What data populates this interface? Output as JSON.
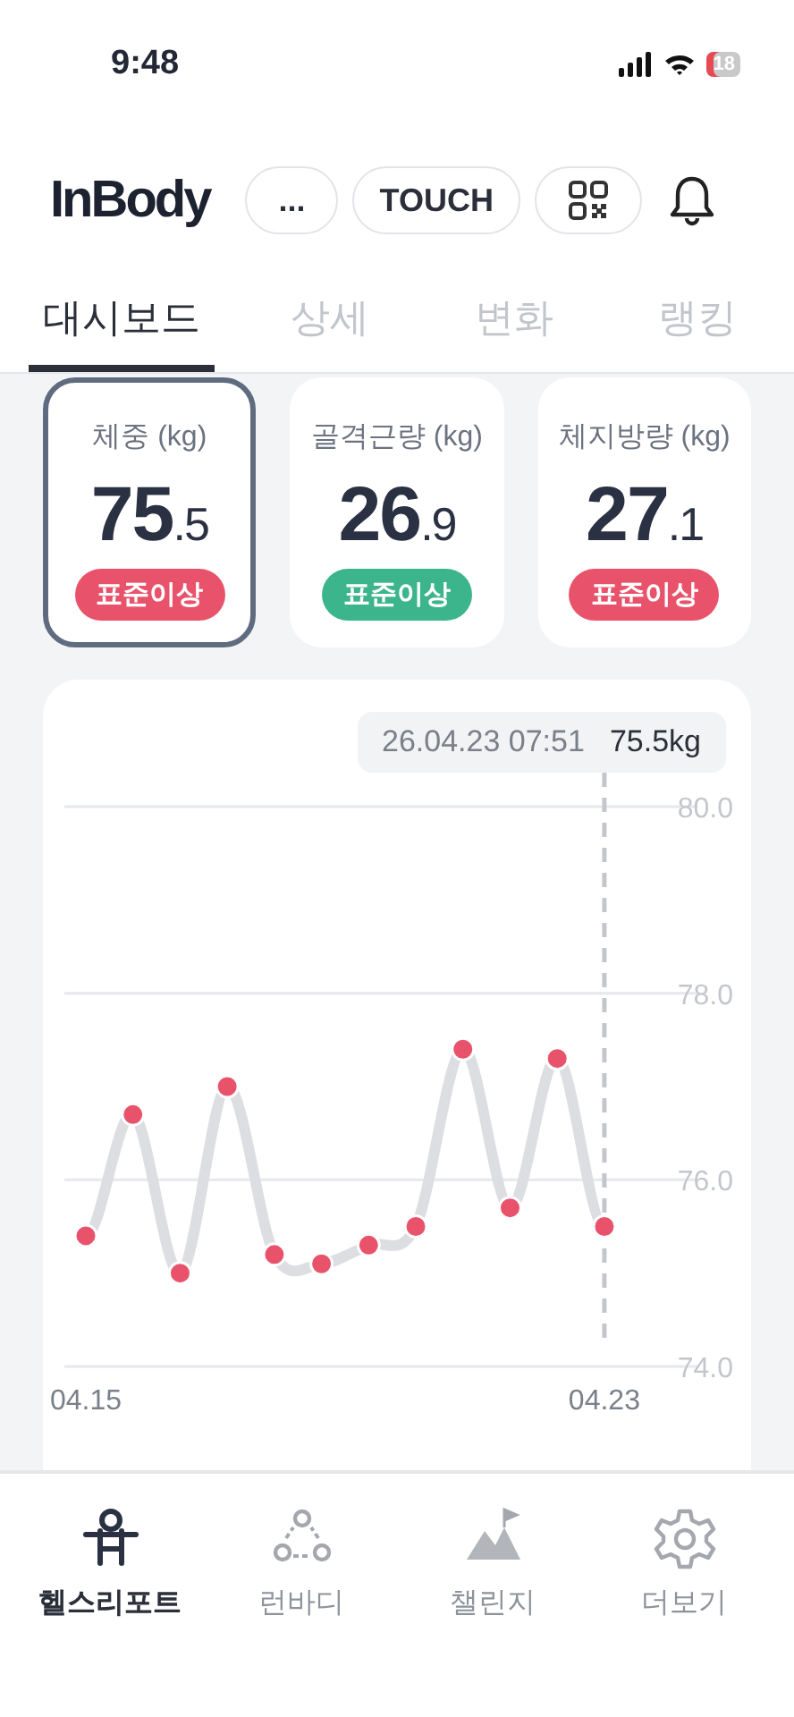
{
  "status_bar": {
    "time": "9:48",
    "battery": "18"
  },
  "header": {
    "logo": "InBody",
    "buttons": [
      {
        "kind": "text",
        "label": "..."
      },
      {
        "kind": "text",
        "label": "TOUCH"
      },
      {
        "kind": "qr"
      }
    ]
  },
  "tabs": [
    {
      "label": "대시보드",
      "selected": true
    },
    {
      "label": "상세",
      "selected": false
    },
    {
      "label": "변화",
      "selected": false
    },
    {
      "label": "랭킹",
      "selected": false
    }
  ],
  "cards": [
    {
      "title": "체중 (kg)",
      "value_main": "75",
      "value_decimal": ".5",
      "badge": "표준이상",
      "color": "#e8536b",
      "selected": true
    },
    {
      "title": "골격근량 (kg)",
      "value_main": "26",
      "value_decimal": ".9",
      "badge": "표준이상",
      "color": "#3cb48c",
      "selected": false
    },
    {
      "title": "체지방량 (kg)",
      "value_main": "27",
      "value_decimal": ".1",
      "badge": "표준이상",
      "color": "#e8536b",
      "selected": false
    }
  ],
  "chart": {
    "tooltip": {
      "date": "26.04.23 07:51",
      "value": "75.5kg"
    },
    "chart_data": {
      "type": "line",
      "categories": [
        "04.15",
        null,
        null,
        null,
        null,
        null,
        null,
        null,
        null,
        null,
        null,
        "04.23"
      ],
      "series": [
        {
          "color": "#dcdee2",
          "marker": "circle",
          "values": [
            75.4,
            76.7,
            75.0,
            77.0,
            75.2,
            75.1,
            75.3,
            75.5,
            77.4,
            75.7,
            77.3,
            75.5
          ]
        }
      ],
      "ylim": [
        74,
        80
      ],
      "yticks": [
        {
          "value": 80,
          "label": "80.0"
        },
        {
          "value": 78,
          "label": "78.0"
        },
        {
          "value": 76,
          "label": "76.0"
        },
        {
          "value": 74,
          "label": "74.0"
        }
      ]
    }
  },
  "nav": [
    {
      "kind": "figure",
      "label": "헬스리포트",
      "selected": true
    },
    {
      "kind": "circles",
      "label": "런바디",
      "selected": false
    },
    {
      "kind": "mountain",
      "label": "챌린지",
      "selected": false
    },
    {
      "kind": "gear",
      "label": "더보기",
      "selected": false
    }
  ]
}
